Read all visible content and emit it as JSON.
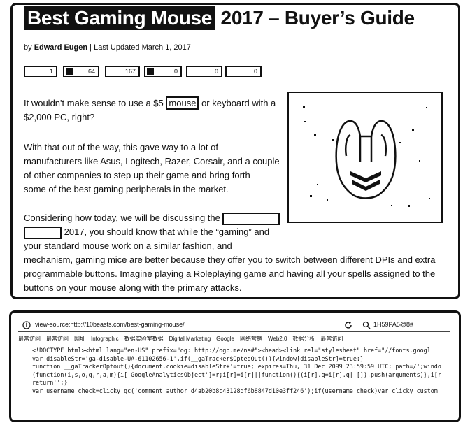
{
  "article": {
    "title_highlight": "Best Gaming Mouse",
    "title_rest": "2017 – Buyer’s Guide",
    "byline_prefix": "by",
    "author": "Edward Eugen",
    "separator": "|",
    "updated": "Last Updated March 1, 2017",
    "share_counts": [
      "1",
      "64",
      "167",
      "0",
      "0"
    ],
    "p1_before": "It wouldn't make sense to use a $5",
    "p1_highlight": "mouse",
    "p1_after": "or keyboard with a",
    "p1_line2": "$2,000 PC, right?",
    "p2_lines": [
      "With that out of the way, this gave way to a lot of",
      "manufacturers like Asus, Logitech, Razer, Corsair, and a couple",
      "of other companies to step up their game and bring forth",
      "some of the best gaming peripherals in the market."
    ],
    "p3_line1": "Considering how today, we will be discussing the",
    "p3_year": "2017,",
    "p3_line2_rest": "you should know that while the “gaming” and",
    "p3_lines": [
      "your standard mouse work on a similar fashion, and",
      "mechanism, gaming mice are better because they offer you to switch between different DPIs and extra",
      "programmable buttons. Imagine playing a Roleplaying game and having all your spells assigned to the",
      "buttons on your mouse along with the primary attacks."
    ]
  },
  "browser": {
    "url": "view-source:http://10beasts.com/best-gaming-mouse/",
    "search_text": "1H59PA5@8#",
    "bookmarks": [
      "最常访问",
      "最常访问",
      "网址",
      "Infographic",
      "数据实验室数据",
      "Digital Marketing",
      "Google",
      "网络营销",
      "Web2.0",
      "数据分析",
      "最常访问"
    ],
    "code_lines": [
      "<!DOCTYPE html><html lang=\"en-US\" prefix=\"og: http://ogp.me/ns#\"><head><link rel=\"stylesheet\" href=\"//fonts.googl",
      "var disableStr='ga-disable-UA-61102656-1',if(__gaTracker$OptedOut()){window[disableStr]=true;}",
      "function __gaTrackerOptout(){document.cookie=disableStr+'=true; expires=Thu, 31 Dec 2099 23:59:59 UTC; path=/';windo",
      "(function(i,s,o,g,r,a,m){i['GoogleAnalyticsObject']=r;i[r]=i[r]||function(){(i[r].q=i[r].q||[]).push(arguments)},i[r",
      "return'';}",
      "var username_check=clicky_gc('comment_author_d4ab20b8c43128df6b8847d10e3ff246');if(username_check)var clicky_custom_"
    ]
  }
}
